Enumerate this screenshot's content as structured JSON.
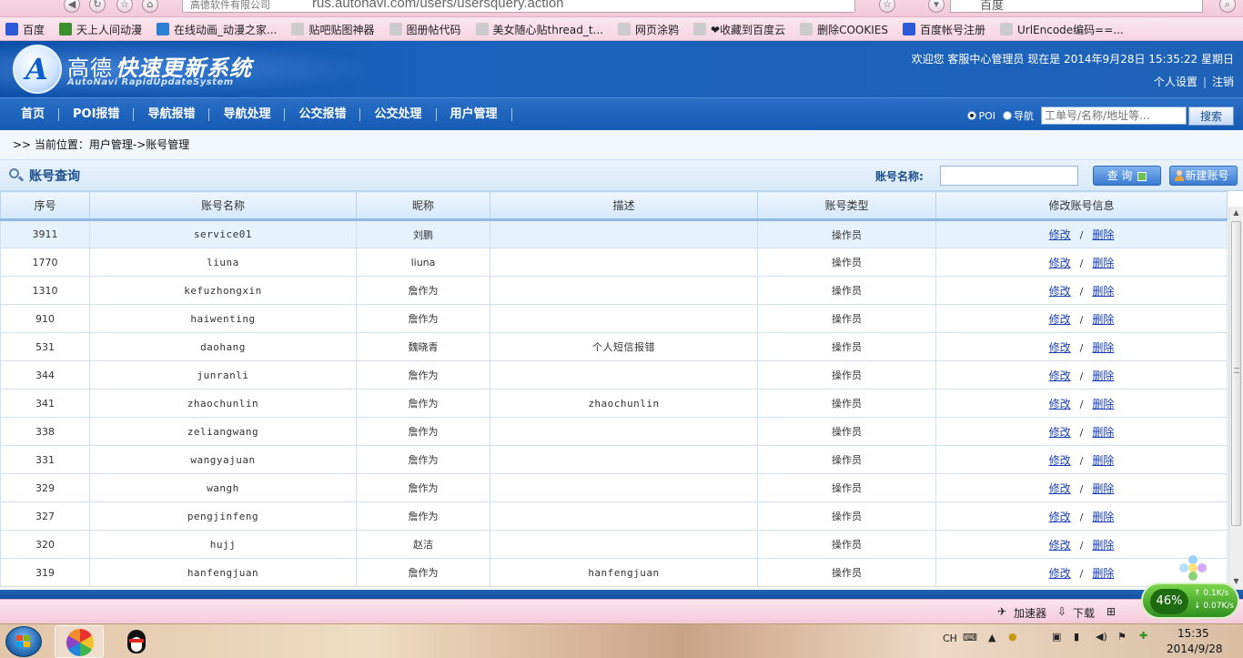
{
  "browser": {
    "tab_title": "高德软件有限公司",
    "url": "rus.autonavi.com/users/usersquery.action",
    "search_engine": "百度",
    "bookmarks": [
      {
        "label": "百度",
        "icon": "baidu-paw-icon",
        "color": "#2d5bd6"
      },
      {
        "label": "天上人间动漫",
        "icon": "tian-icon",
        "color": "#3a8f2e"
      },
      {
        "label": "在线动画_动漫之家...",
        "icon": "man-icon",
        "color": "#2a7fd0"
      },
      {
        "label": "贴吧贴图神器",
        "icon": "page-icon",
        "color": "#cccccc"
      },
      {
        "label": "图册帖代码",
        "icon": "page-icon",
        "color": "#cccccc"
      },
      {
        "label": "美女随心贴thread_t...",
        "icon": "page-icon",
        "color": "#cccccc"
      },
      {
        "label": "网页涂鸦",
        "icon": "page-icon",
        "color": "#cccccc"
      },
      {
        "label": "❤收藏到百度云",
        "icon": "page-icon",
        "color": "#cccccc"
      },
      {
        "label": "删除COOKIES",
        "icon": "page-icon",
        "color": "#cccccc"
      },
      {
        "label": "百度帐号注册",
        "icon": "baidu-paw-icon",
        "color": "#2d5bd6"
      },
      {
        "label": "UrlEncode编码==...",
        "icon": "page-icon",
        "color": "#cccccc"
      }
    ]
  },
  "header": {
    "brand": "高德",
    "system": "快速更新系统",
    "system_en": "AutoNavi RapidUpdateSystem",
    "welcome": "欢迎您  客服中心管理员  现在是 2014年9月28日 15:35:22 星期日",
    "personal_settings": "个人设置",
    "logout": "注销"
  },
  "nav": {
    "items": [
      "首页",
      "POI报错",
      "导航报错",
      "导航处理",
      "公交报错",
      "公交处理",
      "用户管理"
    ],
    "radio_poi": "POI",
    "radio_nav": "导航",
    "search_placeholder": "工单号/名称/地址等...",
    "search_button": "搜索"
  },
  "breadcrumb": ">> 当前位置：用户管理->账号管理",
  "query": {
    "title": "账号查询",
    "name_label": "账号名称:",
    "name_value": "",
    "query_button": "查 询",
    "new_button": "新建账号"
  },
  "table": {
    "headers": [
      "序号",
      "账号名称",
      "昵称",
      "描述",
      "账号类型",
      "修改账号信息"
    ],
    "edit_label": "修改",
    "delete_label": "删除",
    "separator": "/",
    "rows": [
      {
        "id": "3911",
        "account": "service01",
        "nickname": "刘鹏",
        "desc": "",
        "type": "操作员"
      },
      {
        "id": "1770",
        "account": "liuna",
        "nickname": "liuna",
        "desc": "",
        "type": "操作员"
      },
      {
        "id": "1310",
        "account": "kefuzhongxin",
        "nickname": "詹作为",
        "desc": "",
        "type": "操作员"
      },
      {
        "id": "910",
        "account": "haiwenting",
        "nickname": "詹作为",
        "desc": "",
        "type": "操作员"
      },
      {
        "id": "531",
        "account": "daohang",
        "nickname": "魏晓青",
        "desc": "个人短信报错",
        "type": "操作员"
      },
      {
        "id": "344",
        "account": "junranli",
        "nickname": "詹作为",
        "desc": "",
        "type": "操作员"
      },
      {
        "id": "341",
        "account": "zhaochunlin",
        "nickname": "詹作为",
        "desc": "zhaochunlin",
        "type": "操作员"
      },
      {
        "id": "338",
        "account": "zeliangwang",
        "nickname": "詹作为",
        "desc": "",
        "type": "操作员"
      },
      {
        "id": "331",
        "account": "wangyajuan",
        "nickname": "詹作为",
        "desc": "",
        "type": "操作员"
      },
      {
        "id": "329",
        "account": "wangh",
        "nickname": "詹作为",
        "desc": "",
        "type": "操作员"
      },
      {
        "id": "327",
        "account": "pengjinfeng",
        "nickname": "詹作为",
        "desc": "",
        "type": "操作员"
      },
      {
        "id": "320",
        "account": "hujj",
        "nickname": "赵洁",
        "desc": "",
        "type": "操作员"
      },
      {
        "id": "319",
        "account": "hanfengjuan",
        "nickname": "詹作为",
        "desc": "hanfengjuan",
        "type": "操作员"
      }
    ]
  },
  "status_bar": {
    "accelerator": "加速器",
    "download": "下载"
  },
  "speed_widget": {
    "percent": "46%",
    "up": "0.1K/s",
    "down": "0.07K/s"
  },
  "taskbar": {
    "ime": "CH",
    "time": "15:35",
    "date": "2014/9/28"
  }
}
